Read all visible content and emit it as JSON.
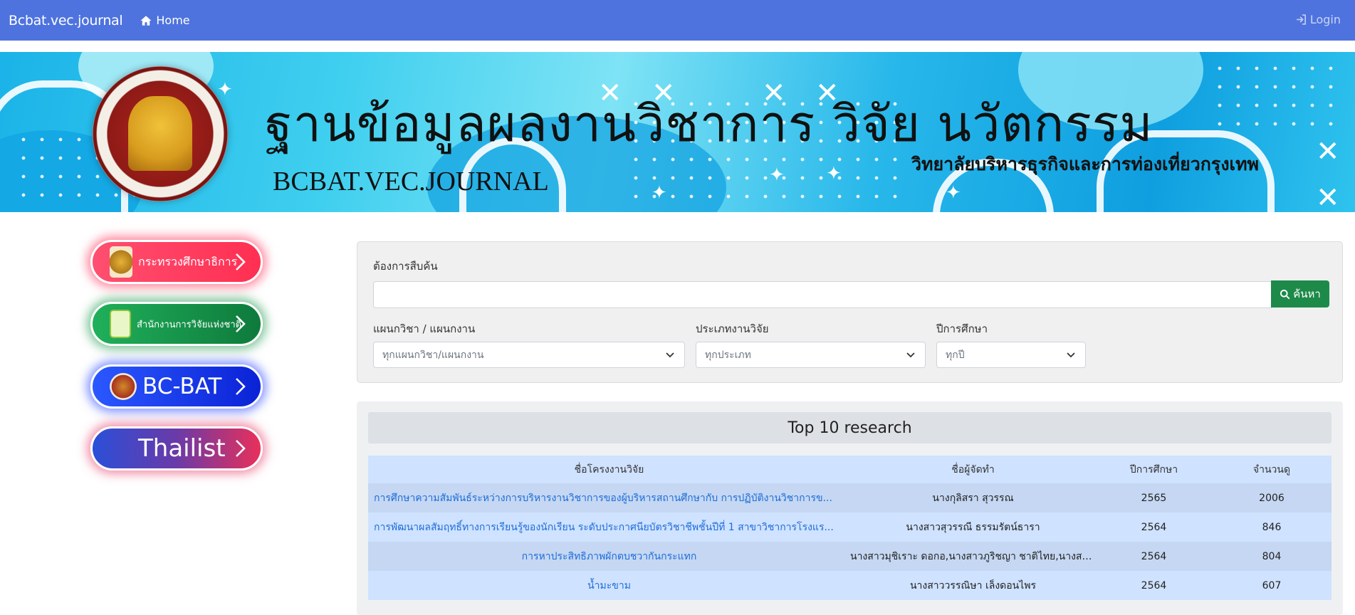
{
  "navbar": {
    "brand": "Bcbat.vec.journal",
    "home_label": "Home",
    "login_label": "Login",
    "color": "#4e73df"
  },
  "banner": {
    "title_th": "ฐานข้อมูลผลงานวิชาการ วิจัย นวัตกรรม",
    "subtitle_th": "วิทยาลัยบริหารธุรกิจและการท่องเที่ยวกรุงเทพ",
    "title_en": "BCBAT.VEC.JOURNAL"
  },
  "sidebar": {
    "links": [
      {
        "label": "กระทรวงศึกษาธิการ",
        "icon": "moe-emblem-icon"
      },
      {
        "label": "สำนักงานการวิจัยแห่งชาติ",
        "icon": "nrct-logo-icon"
      },
      {
        "label": "BC-BAT",
        "icon": "college-seal-icon"
      },
      {
        "label": "Thailist",
        "icon": ""
      }
    ]
  },
  "search": {
    "query_label": "ต้องการสืบค้น",
    "query_value": "",
    "button_label": "ค้นหา",
    "department_label": "แผนกวิชา / แผนกงาน",
    "department_value": "ทุกแผนกวิชา/แผนกงาน",
    "type_label": "ประเภทงานวิจัย",
    "type_value": "ทุกประเภท",
    "year_label": "ปีการศึกษา",
    "year_value": "ทุกปี",
    "button_color": "#1e8a4a"
  },
  "top_research": {
    "heading": "Top 10 research",
    "columns": [
      "ชื่อโครงงานวิจัย",
      "ชื่อผู้จัดทำ",
      "ปีการศึกษา",
      "จำนวนดู"
    ],
    "rows": [
      {
        "title": "การศึกษาความสัมพันธ์ระหว่างการบริหารงานวิชาการของผู้บริหารสถานศึกษากับ การปฏิบัติงานวิชาการข...",
        "author": "นางกุลิสรา สุวรรณ",
        "year": "2565",
        "views": "2006"
      },
      {
        "title": "การพัฒนาผลสัมฤทธิ์ทางการเรียนรู้ของนักเรียน ระดับประกาศนียบัตรวิชาชีพชั้นปีที่ 1 สาขาวิชาการโรงแร...",
        "author": "นางสาวสุวรรณี ธรรมรัตน์ธารา",
        "year": "2564",
        "views": "846"
      },
      {
        "title": "การหาประสิทธิภาพผักตบชวากันกระแทก",
        "author": "นางสาวมุชิเราะ ดอกอ,นางสาวภูริชญา ชาติไทย,นางสาวณัฐิธิ...",
        "year": "2564",
        "views": "804"
      },
      {
        "title": "น้ำมะขาม",
        "author": "นางสาววรรณิษา เล็งดอนไพร",
        "year": "2564",
        "views": "607"
      }
    ]
  }
}
